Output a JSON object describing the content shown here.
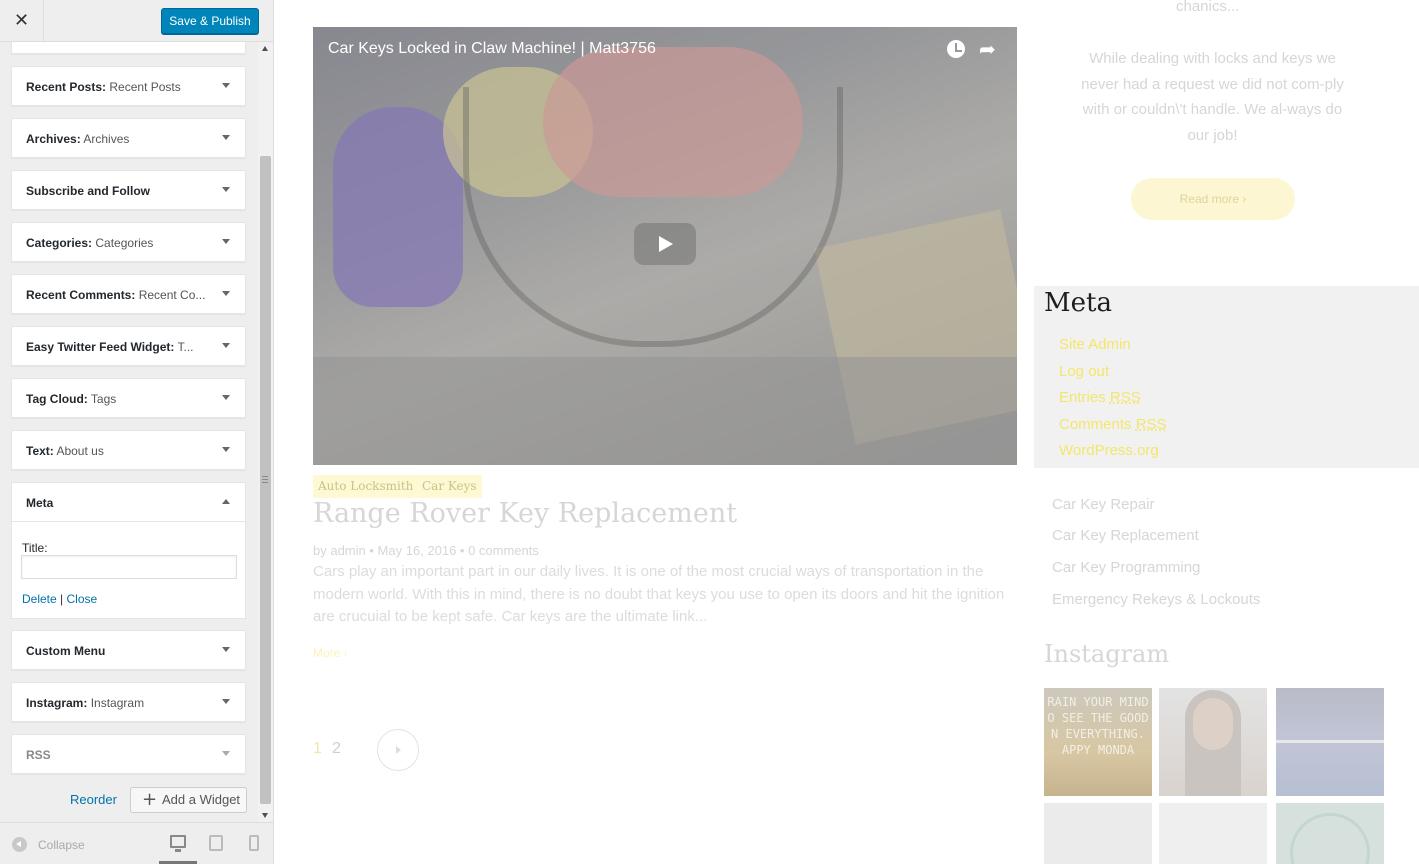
{
  "customizer": {
    "close_label": "✕",
    "save_publish": "Save & Publish",
    "widgets": [
      {
        "name": "Recent Posts:",
        "sub": "Recent Posts"
      },
      {
        "name": "Archives:",
        "sub": "Archives"
      },
      {
        "name": "Subscribe and Follow",
        "sub": ""
      },
      {
        "name": "Categories:",
        "sub": "Categories"
      },
      {
        "name": "Recent Comments:",
        "sub": "Recent Co..."
      },
      {
        "name": "Easy Twitter Feed Widget:",
        "sub": "T..."
      },
      {
        "name": "Tag Cloud:",
        "sub": "Tags"
      },
      {
        "name": "Text:",
        "sub": "About us"
      }
    ],
    "meta_widget": {
      "name": "Meta",
      "title_label": "Title:",
      "title_value": "",
      "delete": "Delete",
      "separator": "|",
      "close": "Close"
    },
    "widgets_after": [
      {
        "name": "Custom Menu",
        "sub": ""
      },
      {
        "name": "Instagram:",
        "sub": "Instagram"
      },
      {
        "name": "RSS",
        "sub": ""
      }
    ],
    "reorder": "Reorder",
    "add_widget": "Add a Widget",
    "collapse": "Collapse"
  },
  "preview": {
    "video": {
      "title": "Car Keys Locked in Claw Machine! | Matt3756"
    },
    "post": {
      "tags": [
        "Auto Locksmith",
        "Car Keys"
      ],
      "title": "Range Rover Key Replacement",
      "meta": "by admin  •  May 16, 2016  •  0 comments",
      "excerpt": "Cars play an important part in our daily lives. It is one of the most crucial ways of transportation in the modern world. With this in mind, there is no doubt that keys you use to open its doors and hit the ignition are crucuial to be kept safe. Car keys are the ultimate link...",
      "more": "More  ›"
    },
    "pagination": {
      "page_1": "1",
      "page_2": "2"
    },
    "sidebar": {
      "top_text": "chanics...",
      "text": "While dealing with locks and keys we never had a request we did not com-ply with or couldn\\'t handle. We al-ways do our job!",
      "read_more": "Read more  ›",
      "meta_heading": "Meta",
      "meta_links": [
        "Site Admin",
        "Log out",
        "Entries ",
        "Comments ",
        "WordPress.org"
      ],
      "meta_abbr": "RSS",
      "categories": [
        "Car Key Repair",
        "Car Key Replacement",
        "Car Key Programming",
        "Emergency Rekeys & Lockouts"
      ],
      "instagram_heading": "Instagram",
      "instagram_1_text": "RAIN YOUR MIND O SEE THE GOOD N EVERYTHING. APPY MONDA"
    }
  }
}
